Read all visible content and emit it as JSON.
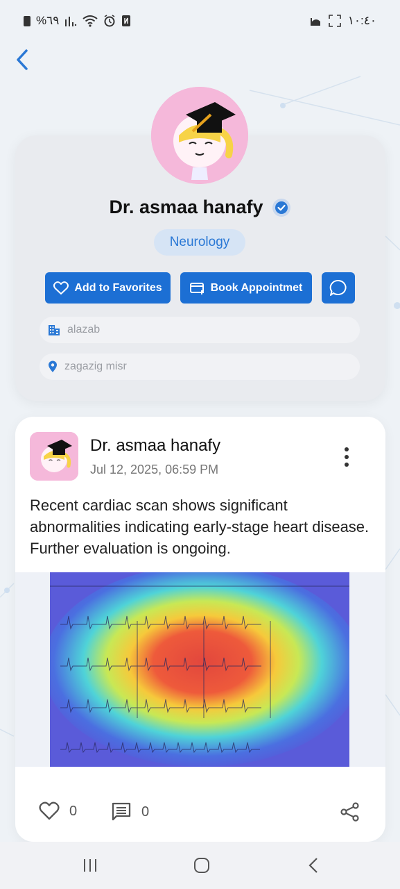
{
  "status_bar": {
    "battery_percent": "%٦٩",
    "time": "١٠:٤٠"
  },
  "profile": {
    "name": "Dr. asmaa hanafy",
    "specialty": "Neurology",
    "add_favorites_label": "Add to Favorites",
    "book_appointment_label": "Book Appointmet",
    "hospital": "alazab",
    "location": "zagazig misr"
  },
  "post": {
    "author": "Dr. asmaa hanafy",
    "date": "Jul 12, 2025, 06:59 PM",
    "text": "Recent cardiac scan shows significant abnormalities indicating early-stage heart disease. Further evaluation is ongoing.",
    "likes": "0",
    "comments": "0"
  },
  "colors": {
    "accent": "#1c6fd4",
    "specialty_bg": "#d6e4f5",
    "specialty_text": "#2a78d5",
    "background": "#eef2f6"
  },
  "icons": {
    "back": "chevron-left-icon",
    "verified": "verified-badge-icon",
    "heart": "heart-icon",
    "calendar": "calendar-plus-icon",
    "chat": "chat-bubble-icon",
    "building": "building-icon",
    "pin": "location-pin-icon",
    "menu": "more-vertical-icon",
    "comment": "comment-icon",
    "share": "share-icon"
  }
}
